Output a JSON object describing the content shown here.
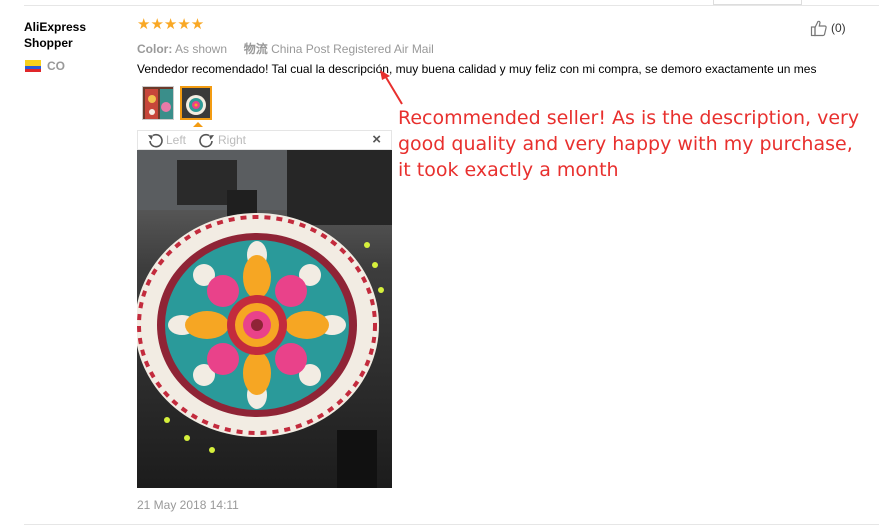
{
  "review": {
    "buyer_name": "AliExpress Shopper",
    "country": "CO",
    "rating": 5,
    "stars": "★★★★★",
    "color_label": "Color:",
    "color_value": "As shown",
    "shipping_label": "物流",
    "shipping_value": "China Post Registered Air Mail",
    "text": "Vendedor recomendado! Tal cual la descripción, muy buena calidad y muy feliz con mi compra, se demoro exactamente un mes",
    "helpful_count": "(0)",
    "date": "21 May 2018 14:11"
  },
  "viewer": {
    "rotate_left": "Left",
    "rotate_right": "Right",
    "close": "×"
  },
  "annotation": {
    "translation": "Recommended seller! As is the description, very good quality and very happy with my purchase, it took exactly a month"
  },
  "colors": {
    "star": "#f9a825",
    "accent": "#f39c12",
    "annotation": "#e8302e"
  }
}
